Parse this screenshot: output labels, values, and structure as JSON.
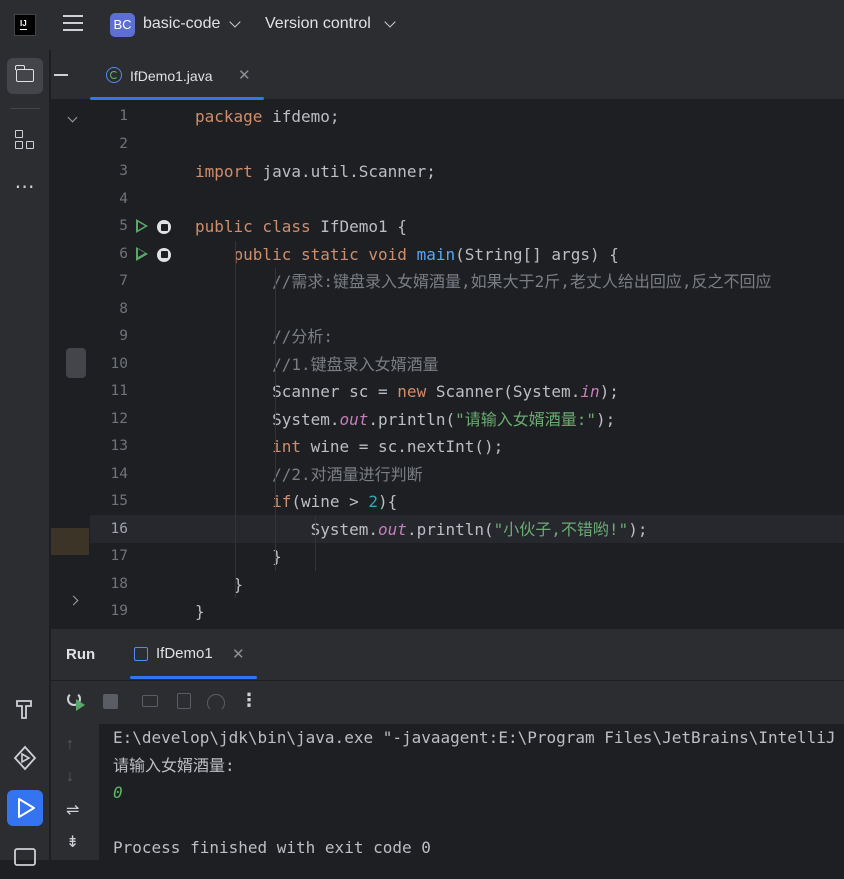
{
  "titlebar": {
    "project_badge": "BC",
    "project_name": "basic-code",
    "vcs_label": "Version control"
  },
  "editor": {
    "tab_label": "IfDemo1.java",
    "current_line": 16,
    "lines": [
      {
        "n": "1",
        "code": [
          {
            "t": "package ",
            "c": "kw"
          },
          {
            "t": "ifdemo;",
            "c": ""
          }
        ]
      },
      {
        "n": "2",
        "code": []
      },
      {
        "n": "3",
        "code": [
          {
            "t": "import ",
            "c": "kw"
          },
          {
            "t": "java.util.Scanner;",
            "c": ""
          }
        ]
      },
      {
        "n": "4",
        "code": []
      },
      {
        "n": "5",
        "run": true,
        "code": [
          {
            "t": "public class ",
            "c": "kw"
          },
          {
            "t": "IfDemo1 {",
            "c": ""
          }
        ]
      },
      {
        "n": "6",
        "run": true,
        "code": [
          {
            "t": "    public static void ",
            "c": "kw"
          },
          {
            "t": "main",
            "c": "fn"
          },
          {
            "t": "(String[] args) {",
            "c": ""
          }
        ]
      },
      {
        "n": "7",
        "code": [
          {
            "t": "        //需求:键盘录入女婿酒量,如果大于2斤,老丈人给出回应,反之不回应",
            "c": "cmt"
          }
        ]
      },
      {
        "n": "8",
        "code": []
      },
      {
        "n": "9",
        "code": [
          {
            "t": "        //分析:",
            "c": "cmt"
          }
        ]
      },
      {
        "n": "10",
        "code": [
          {
            "t": "        //1.键盘录入女婿酒量",
            "c": "cmt"
          }
        ]
      },
      {
        "n": "11",
        "code": [
          {
            "t": "        Scanner sc = ",
            "c": ""
          },
          {
            "t": "new ",
            "c": "kw"
          },
          {
            "t": "Scanner(System.",
            "c": ""
          },
          {
            "t": "in",
            "c": "st"
          },
          {
            "t": ");",
            "c": ""
          }
        ]
      },
      {
        "n": "12",
        "code": [
          {
            "t": "        System.",
            "c": ""
          },
          {
            "t": "out",
            "c": "st"
          },
          {
            "t": ".println(",
            "c": ""
          },
          {
            "t": "\"请输入女婿酒量:\"",
            "c": "str"
          },
          {
            "t": ");",
            "c": ""
          }
        ]
      },
      {
        "n": "13",
        "code": [
          {
            "t": "        ",
            "c": ""
          },
          {
            "t": "int ",
            "c": "kw"
          },
          {
            "t": "wine = sc.nextInt();",
            "c": ""
          }
        ]
      },
      {
        "n": "14",
        "code": [
          {
            "t": "        //2.对酒量进行判断",
            "c": "cmt"
          }
        ]
      },
      {
        "n": "15",
        "code": [
          {
            "t": "        ",
            "c": ""
          },
          {
            "t": "if",
            "c": "kw"
          },
          {
            "t": "(wine > ",
            "c": ""
          },
          {
            "t": "2",
            "c": "num"
          },
          {
            "t": "){",
            "c": ""
          }
        ]
      },
      {
        "n": "16",
        "code": [
          {
            "t": "            System.",
            "c": ""
          },
          {
            "t": "out",
            "c": "st"
          },
          {
            "t": ".println(",
            "c": ""
          },
          {
            "t": "\"小伙子,不错哟!\"",
            "c": "str"
          },
          {
            "t": ");",
            "c": ""
          }
        ]
      },
      {
        "n": "17",
        "code": [
          {
            "t": "        }",
            "c": ""
          }
        ]
      },
      {
        "n": "18",
        "code": [
          {
            "t": "    }",
            "c": ""
          }
        ]
      },
      {
        "n": "19",
        "code": [
          {
            "t": "}",
            "c": ""
          }
        ]
      }
    ]
  },
  "run_panel": {
    "title": "Run",
    "tab_label": "IfDemo1",
    "console": [
      {
        "text": "E:\\develop\\jdk\\bin\\java.exe \"-javaagent:E:\\Program Files\\JetBrains\\IntelliJ IDEA",
        "kind": "cmd"
      },
      {
        "text": "请输入女婿酒量:",
        "kind": "out"
      },
      {
        "text": "0",
        "kind": "input"
      },
      {
        "text": "",
        "kind": "out"
      },
      {
        "text": "Process finished with exit code 0",
        "kind": "out"
      }
    ]
  },
  "colors": {
    "accent": "#3574f0",
    "keyword": "#cf8e6d",
    "string": "#6aab73",
    "comment": "#7a7e85",
    "run_green": "#59a869"
  }
}
